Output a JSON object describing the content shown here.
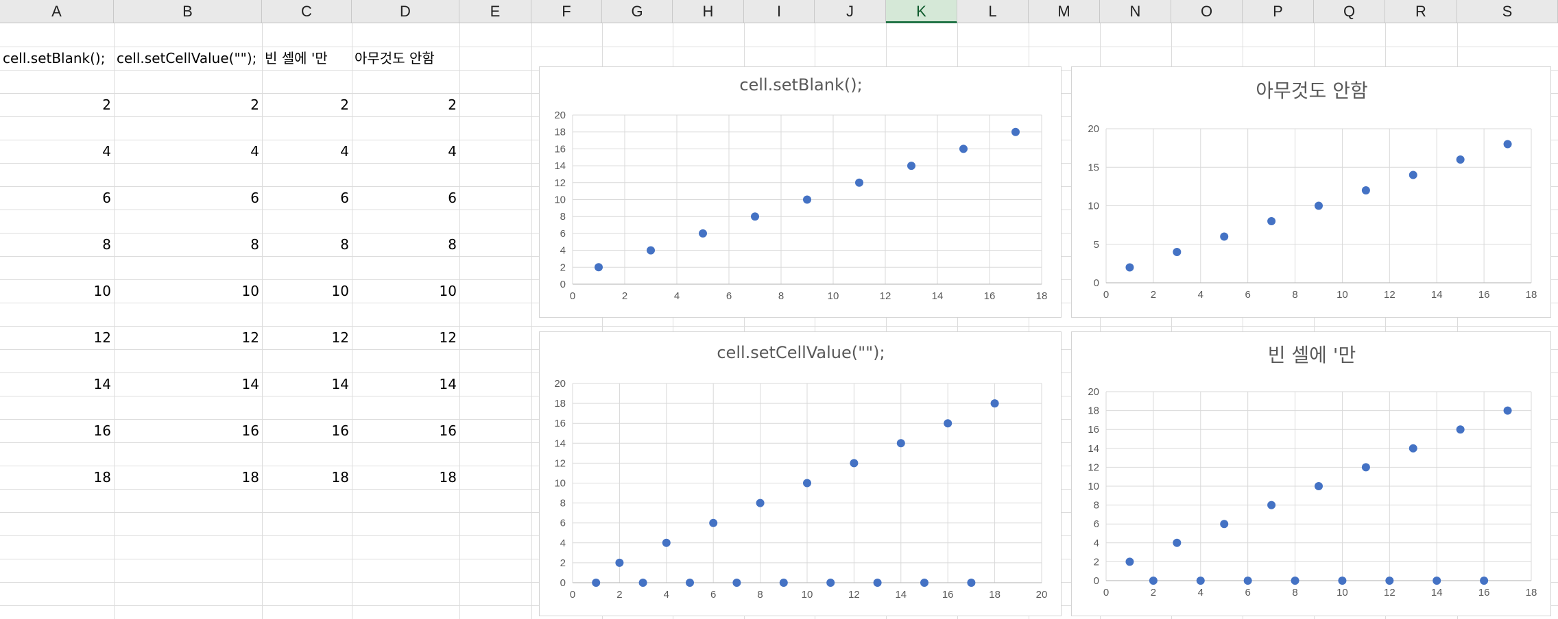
{
  "columns": [
    {
      "label": "A"
    },
    {
      "label": "B"
    },
    {
      "label": "C"
    },
    {
      "label": "D"
    },
    {
      "label": "E"
    },
    {
      "label": "F"
    },
    {
      "label": "G"
    },
    {
      "label": "H"
    },
    {
      "label": "I"
    },
    {
      "label": "J"
    },
    {
      "label": "K",
      "selected": true
    },
    {
      "label": "L"
    },
    {
      "label": "M"
    },
    {
      "label": "N"
    },
    {
      "label": "O"
    },
    {
      "label": "P"
    },
    {
      "label": "Q"
    },
    {
      "label": "R"
    },
    {
      "label": "S"
    }
  ],
  "headers": {
    "a": "cell.setBlank();",
    "b": "cell.setCellValue(\"\");",
    "c": "빈 셀에 '만",
    "d": "아무것도 안함"
  },
  "values": {
    "col_a": [
      "2",
      "4",
      "6",
      "8",
      "10",
      "12",
      "14",
      "16",
      "18"
    ],
    "col_b": [
      "2",
      "4",
      "6",
      "8",
      "10",
      "12",
      "14",
      "16",
      "18"
    ],
    "col_c": [
      "2",
      "4",
      "6",
      "8",
      "10",
      "12",
      "14",
      "16",
      "18"
    ],
    "col_d": [
      "2",
      "4",
      "6",
      "8",
      "10",
      "12",
      "14",
      "16",
      "18"
    ]
  },
  "chart_data": [
    {
      "type": "scatter",
      "title": "cell.setBlank();",
      "x": [
        1,
        3,
        5,
        7,
        9,
        11,
        13,
        15,
        17
      ],
      "y": [
        2,
        4,
        6,
        8,
        10,
        12,
        14,
        16,
        18
      ],
      "xlim": [
        0,
        18
      ],
      "ylim": [
        0,
        20
      ],
      "xticks": [
        "0",
        "2",
        "4",
        "6",
        "8",
        "10",
        "12",
        "14",
        "16",
        "18"
      ],
      "yticks": [
        "0",
        "2",
        "4",
        "6",
        "8",
        "10",
        "12",
        "14",
        "16",
        "18",
        "20"
      ],
      "grid": true,
      "color": "#4472c4"
    },
    {
      "type": "scatter",
      "title": "아무것도 안함",
      "x": [
        1,
        3,
        5,
        7,
        9,
        11,
        13,
        15,
        17
      ],
      "y": [
        2,
        4,
        6,
        8,
        10,
        12,
        14,
        16,
        18
      ],
      "xlim": [
        0,
        18
      ],
      "ylim": [
        0,
        20
      ],
      "xticks": [
        "0",
        "2",
        "4",
        "6",
        "8",
        "10",
        "12",
        "14",
        "16",
        "18"
      ],
      "yticks": [
        "0",
        "5",
        "10",
        "15",
        "20"
      ],
      "grid": true,
      "color": "#4472c4"
    },
    {
      "type": "scatter",
      "title": "cell.setCellValue(\"\");",
      "x": [
        1,
        2,
        3,
        4,
        5,
        6,
        7,
        8,
        9,
        10,
        11,
        12,
        13,
        14,
        15,
        16,
        17,
        18
      ],
      "y": [
        0,
        2,
        0,
        4,
        0,
        6,
        0,
        8,
        0,
        10,
        0,
        12,
        0,
        14,
        0,
        16,
        0,
        18
      ],
      "xlim": [
        0,
        20
      ],
      "ylim": [
        0,
        20
      ],
      "xticks": [
        "0",
        "2",
        "4",
        "6",
        "8",
        "10",
        "12",
        "14",
        "16",
        "18",
        "20"
      ],
      "yticks": [
        "0",
        "2",
        "4",
        "6",
        "8",
        "10",
        "12",
        "14",
        "16",
        "18",
        "20"
      ],
      "grid": true,
      "color": "#4472c4"
    },
    {
      "type": "scatter",
      "title": "빈 셀에 '만",
      "x": [
        1,
        2,
        3,
        4,
        5,
        6,
        7,
        8,
        9,
        10,
        11,
        12,
        13,
        14,
        15,
        16,
        17
      ],
      "y": [
        2,
        0,
        4,
        0,
        6,
        0,
        8,
        0,
        10,
        0,
        12,
        0,
        14,
        0,
        16,
        0,
        18
      ],
      "xlim": [
        0,
        18
      ],
      "ylim": [
        0,
        20
      ],
      "xticks": [
        "0",
        "2",
        "4",
        "6",
        "8",
        "10",
        "12",
        "14",
        "16",
        "18"
      ],
      "yticks": [
        "0",
        "2",
        "4",
        "6",
        "8",
        "10",
        "12",
        "14",
        "16",
        "18",
        "20"
      ],
      "grid": true,
      "color": "#4472c4"
    }
  ]
}
